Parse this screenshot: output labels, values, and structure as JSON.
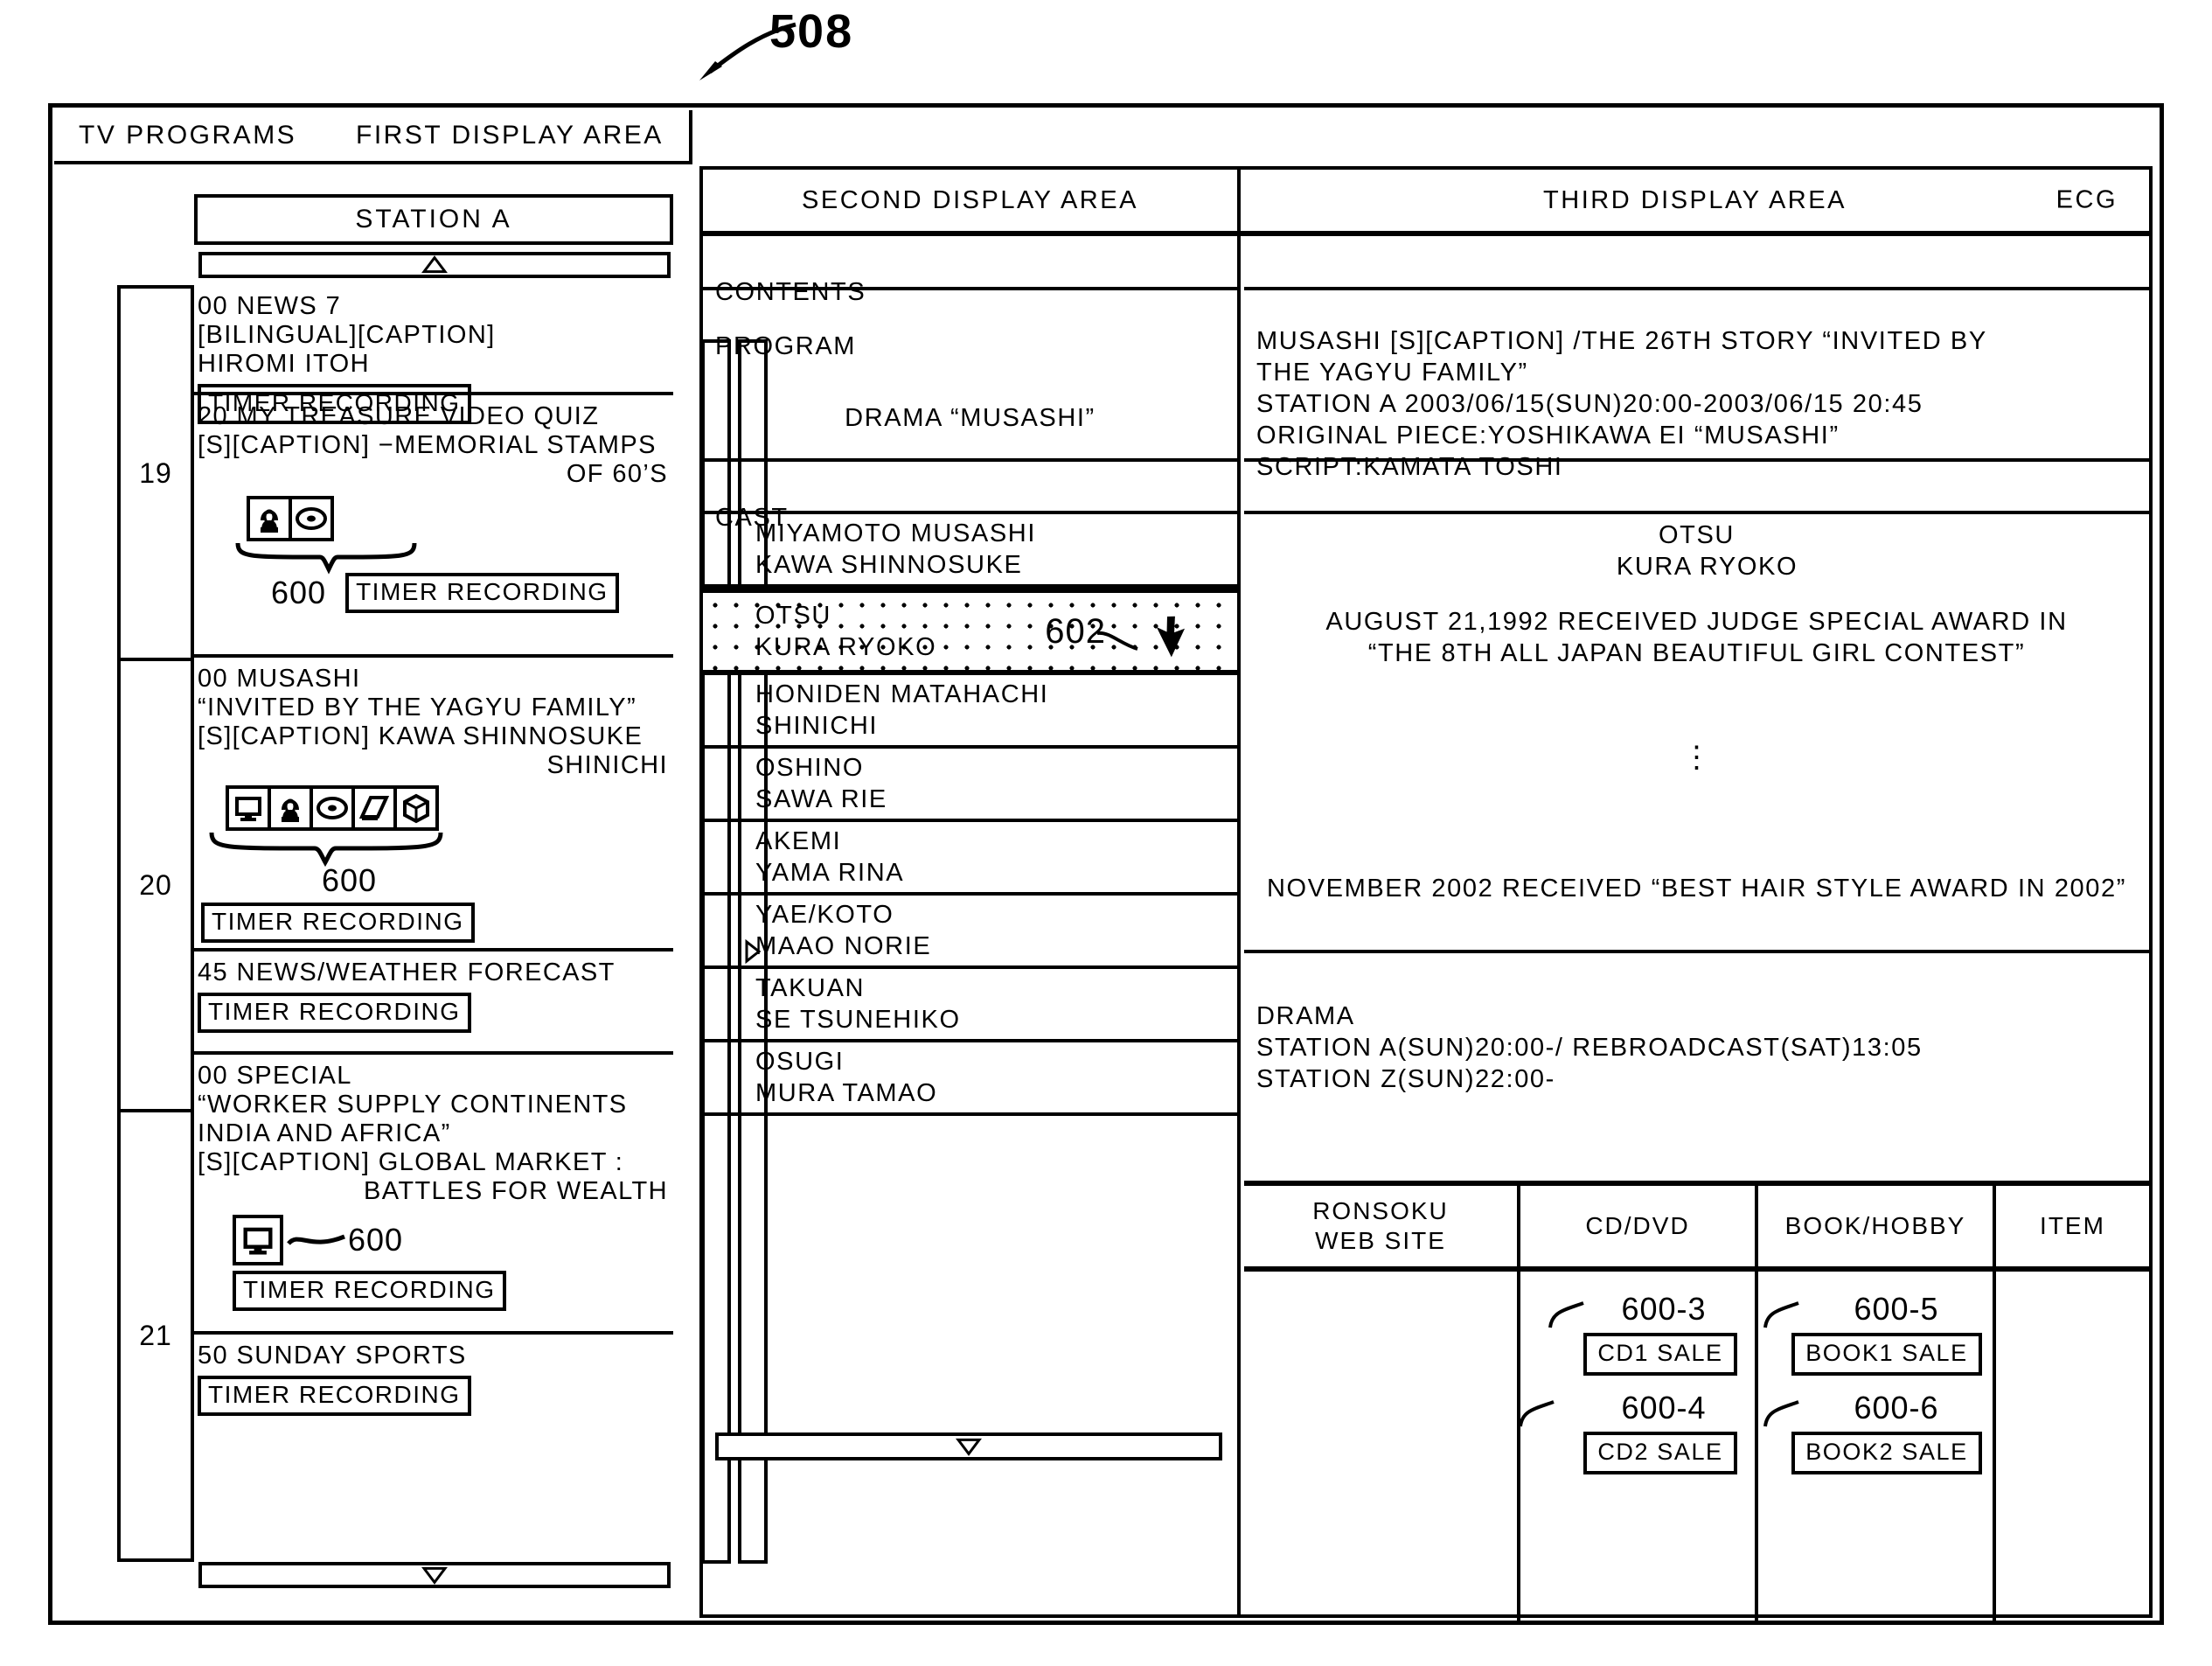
{
  "figure": {
    "reference_number": "508"
  },
  "first_display": {
    "panel_label_left": "TV PROGRAMS",
    "panel_label_right": "FIRST DISPLAY AREA",
    "station": "STATION A",
    "scroll_up_icon": "triangle-up-icon",
    "scroll_down_icon": "triangle-down-icon",
    "hours": [
      "19",
      "20",
      "21"
    ],
    "programs": [
      {
        "title": "00 NEWS 7\n[BILINGUAL][CAPTION]\nHIROMI ITOH",
        "timer_label": "TIMER RECORDING",
        "icons": [],
        "callout": ""
      },
      {
        "title": "20 MY TREASURE VIDEO QUIZ\n[S][CAPTION] −MEMORIAL STAMPS",
        "title_right": "OF 60’S",
        "timer_label": "TIMER RECORDING",
        "icons": [
          "person-icon",
          "disc-icon"
        ],
        "callout": "600"
      },
      {
        "title": "00 MUSASHI\n“INVITED BY THE YAGYU FAMILY”\n[S][CAPTION] KAWA SHINNOSUKE",
        "title_right": "SHINICHI",
        "timer_label": "TIMER RECORDING",
        "icons": [
          "monitor-icon",
          "person-icon",
          "disc-icon",
          "book-icon",
          "box-icon"
        ],
        "callout": "600"
      },
      {
        "title": "45 NEWS/WEATHER FORECAST",
        "timer_label": "TIMER RECORDING",
        "icons": [],
        "callout": ""
      },
      {
        "title": "00 SPECIAL\n“WORKER SUPPLY CONTINENTS\n  INDIA AND AFRICA”\n[S][CAPTION] GLOBAL MARKET :",
        "title_right": "BATTLES FOR WEALTH",
        "timer_label": "TIMER RECORDING",
        "icons": [
          "monitor-icon"
        ],
        "callout": "600"
      },
      {
        "title": "50 SUNDAY SPORTS",
        "timer_label": "TIMER RECORDING",
        "icons": [],
        "callout": ""
      }
    ]
  },
  "second_display": {
    "header": "SECOND DISPLAY AREA",
    "contents_label": "CONTENTS",
    "program_label": "PROGRAM",
    "program_value": "DRAMA “MUSASHI”",
    "cast_label": "CAST",
    "cast": [
      {
        "role": "MIYAMOTO MUSASHI",
        "actor": "KAWA SHINNOSUKE",
        "highlighted": false
      },
      {
        "role": "OTSU",
        "actor": "KURA RYOKO",
        "highlighted": true,
        "callout": "602",
        "cursor_icon": "pointer-cursor-icon"
      },
      {
        "role": "HONIDEN MATAHACHI",
        "actor": "SHINICHI",
        "highlighted": false
      },
      {
        "role": "OSHINO",
        "actor": "SAWA RIE",
        "highlighted": false
      },
      {
        "role": "AKEMI",
        "actor": "YAMA RINA",
        "highlighted": false
      },
      {
        "role": "YAE/KOTO",
        "actor": "MAAO NORIE",
        "highlighted": false
      },
      {
        "role": "TAKUAN",
        "actor": "SE TSUNEHIKO",
        "highlighted": false
      },
      {
        "role": "OSUGI",
        "actor": "MURA TAMAO",
        "highlighted": false
      }
    ],
    "scroll_down_icon": "triangle-down-icon"
  },
  "third_display": {
    "header": "THIRD DISPLAY AREA",
    "ecg_label": "ECG",
    "contents_value": "",
    "program_detail": "MUSASHI [S][CAPTION] /THE 26TH STORY  “INVITED BY\nTHE YAGYU FAMILY”\nSTATION A 2003/06/15(SUN)20:00-2003/06/15 20:45\nORIGINAL PIECE:YOSHIKAWA EI “MUSASHI”\nSCRIPT:KAMATA TOSHI",
    "cast_header_blank": "",
    "detail_rows": [
      {
        "line1": "OTSU",
        "line2": "KURA RYOKO",
        "centered": true
      },
      {
        "text": "AUGUST 21,1992 RECEIVED JUDGE SPECIAL AWARD IN\n“THE 8TH ALL JAPAN BEAUTIFUL GIRL CONTEST”",
        "centered": true
      },
      {
        "text": "⋮",
        "vertical_dots": true
      },
      {
        "text": "NOVEMBER 2002 RECEIVED  “BEST HAIR STYLE AWARD IN 2002”",
        "centered": true
      },
      {
        "text": "DRAMA\nSTATION A(SUN)20:00-/ REBROADCAST(SAT)13:05\nSTATION Z(SUN)22:00-",
        "centered": false
      }
    ],
    "shop": {
      "columns": [
        "RONSOKU\nWEB SITE",
        "CD/DVD",
        "BOOK/HOBBY",
        "ITEM"
      ],
      "cd_dvd": [
        {
          "callout": "600-3",
          "label": "CD1 SALE"
        },
        {
          "callout": "600-4",
          "label": "CD2 SALE"
        }
      ],
      "book_hobby": [
        {
          "callout": "600-5",
          "label": "BOOK1 SALE"
        },
        {
          "callout": "600-6",
          "label": "BOOK2 SALE"
        }
      ],
      "ronsoku": [],
      "item": []
    }
  }
}
